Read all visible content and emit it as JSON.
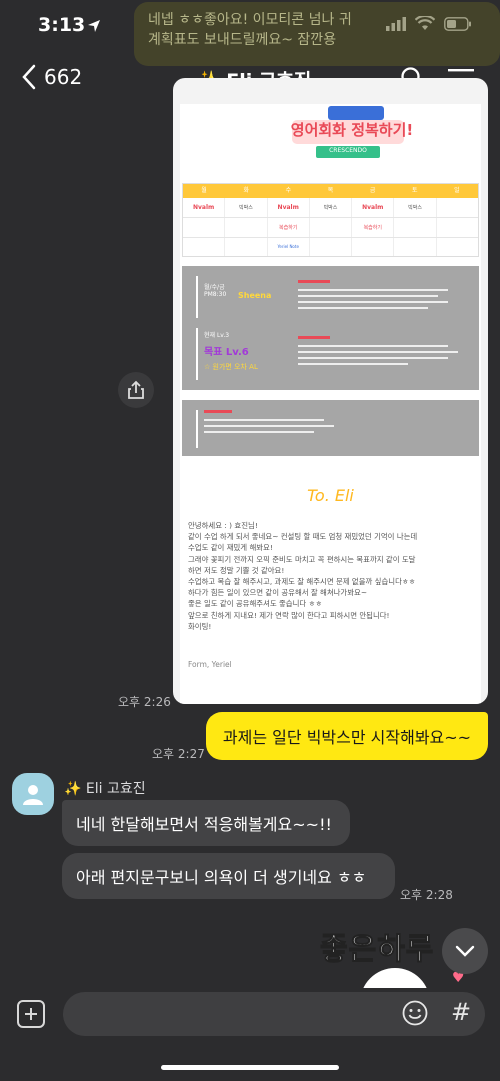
{
  "status": {
    "time": "3:13"
  },
  "banner": {
    "line1": "네넵 ㅎㅎ좋아요! 이모티콘 넘나 귀",
    "line2": "계획표도 보내드릴께요~ 잠깐용"
  },
  "header": {
    "back_count": "662",
    "title": "✨ Eli 고효진"
  },
  "poster": {
    "badge_line": "CRESCENDO",
    "headline": "영어회화 정복하기!",
    "days": [
      "월",
      "화",
      "수",
      "목",
      "금",
      "토",
      "일"
    ],
    "row1": [
      "Nvalm",
      "빅박스",
      "Nvalm",
      "빅박스",
      "Nvalm",
      "빅박스",
      ""
    ],
    "row2": [
      "",
      "",
      "복습하기",
      "",
      "복습하기",
      "",
      ""
    ],
    "row3": [
      "",
      "",
      "Yeriel Note",
      "",
      "",
      "",
      ""
    ],
    "sched_label": "월/수/금\nPM8:30",
    "sched_name": "Sheena",
    "level_now": "현재 Lv.3",
    "level_goal": "목표 Lv.6",
    "goal_note": "☆ 원가면 오차 AL",
    "to_line": "To. Eli",
    "letter": [
      "안녕하세요 : ) 효진님!",
      "같이 수업 하게 되서 좋네요~ 컨설팅 할 때도 엄청 재밌었던 기억이 나는데",
      "수업도 같이 재밌게 해봐요!",
      "그래야 꽃피기 전까지 오픽 준비도 마치고 꼭 편하시는 목표까지 같이 도달",
      "하면 저도 정말 기쁠 것 같아요!",
      "수업하고 복습 잘 해주시고, 과제도 잘 해주시면 문제 없을까 싶습니다ㅎㅎ",
      "하다가 힘든 일이 있으면 같이 공유해서 잘 해쳐나가봐요~",
      "좋은 일도 같이 공유해주셔도 좋습니다 ㅎㅎ",
      "앞으로 친하게 지내요! 제가 연락 많이 한다고 피하시면 안됩니다!",
      "화이팅!"
    ],
    "sign": "Form, Yeriel"
  },
  "messages": {
    "img_time": "오후 2:26",
    "me_text": "과제는 일단 빅박스만 시작해봐요~~",
    "me_time": "오후 2:27",
    "sender": "✨ Eli 고효진",
    "reply1": "네네 한달해보면서 적응해볼게요~~!!",
    "reply2": "아래 편지문구보니 의욕이 더 생기네요 ㅎㅎ",
    "reply_time": "오후 2:28",
    "sticker_text": "좋은하루"
  },
  "input": {
    "placeholder": ""
  },
  "colors": {
    "accent": "#ffe812",
    "background": "#2c2c2e",
    "bubble_other": "#434345"
  }
}
